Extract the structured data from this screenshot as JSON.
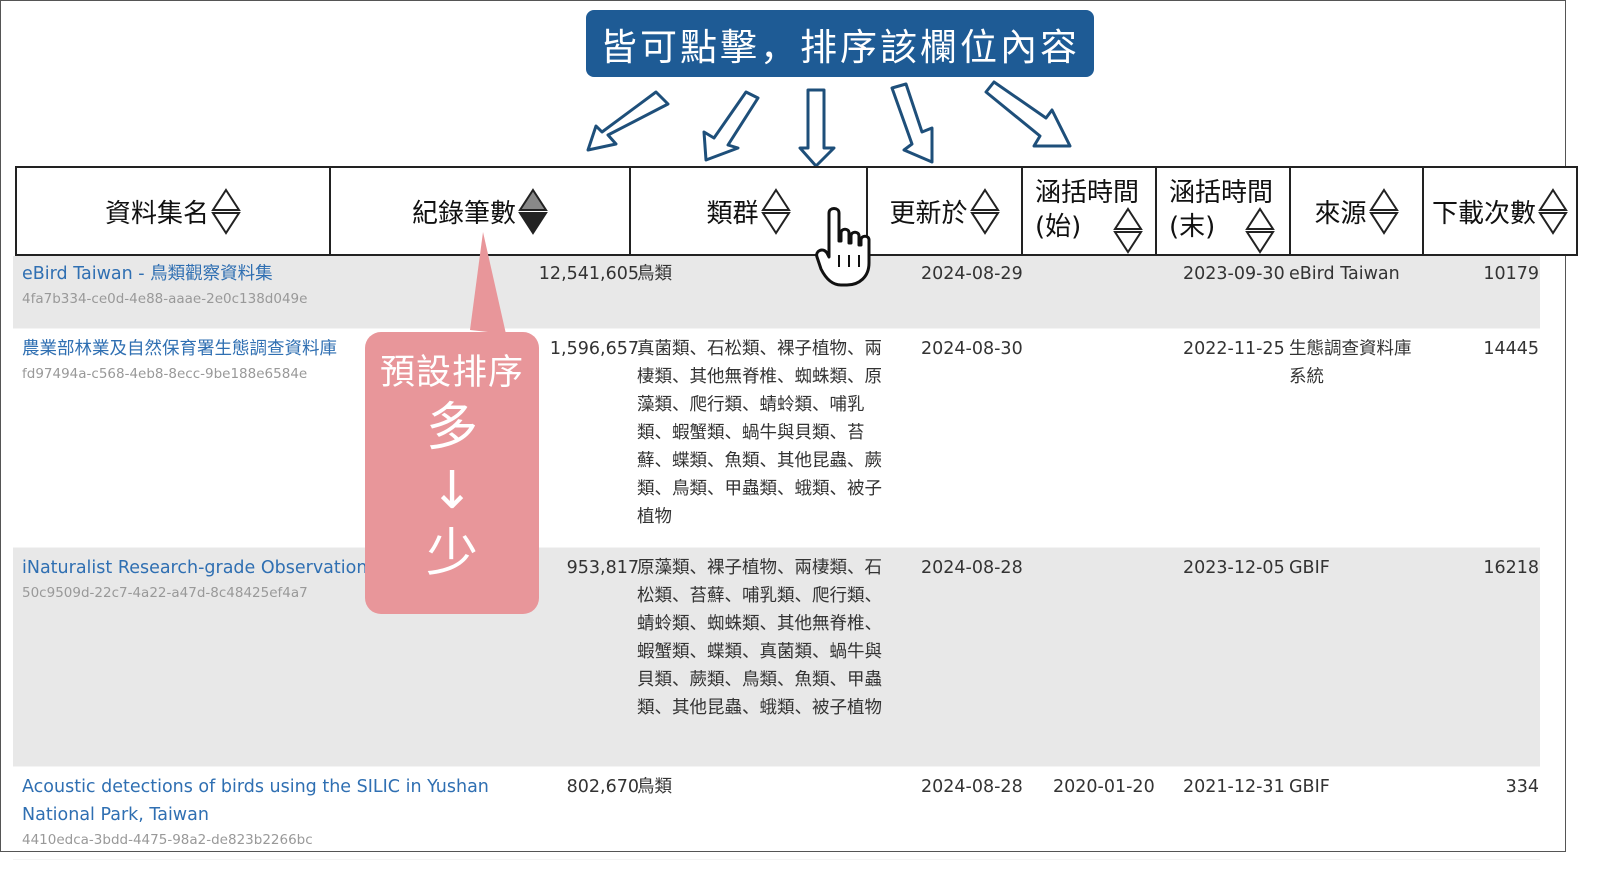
{
  "callout_top": {
    "text": "皆可點擊，排序該欄位內容",
    "color": "#1e5b95"
  },
  "callout_sort": {
    "line1": "預設排序",
    "line2": "多",
    "arrow": "↓",
    "line3": "少",
    "color": "#e8969a"
  },
  "headers": [
    {
      "label": "資料集名",
      "icon": "sort-both-icon"
    },
    {
      "label": "紀錄筆數",
      "icon": "sort-desc-active-icon"
    },
    {
      "label": "類群",
      "icon": "sort-both-icon"
    },
    {
      "label": "更新於",
      "icon": "sort-both-icon"
    },
    {
      "label_line1": "涵括時間",
      "label_line2": "(始)",
      "icon": "sort-both-icon"
    },
    {
      "label_line1": "涵括時間",
      "label_line2": "(末)",
      "icon": "sort-both-icon"
    },
    {
      "label": "來源",
      "icon": "sort-both-icon"
    },
    {
      "label": "下載次數",
      "icon": "sort-both-icon"
    }
  ],
  "rows": [
    {
      "name": "eBird Taiwan - 鳥類觀察資料集",
      "uuid": "4fa7b334-ce0d-4e88-aaae-2e0c138d049e",
      "records": "12,541,605",
      "taxa": "鳥類",
      "updated": "2024-08-29",
      "start": "",
      "end": "2023-09-30",
      "source": "eBird Taiwan",
      "downloads": "10179"
    },
    {
      "name": "農業部林業及自然保育署生態調查資料庫",
      "uuid": "fd97494a-c568-4eb8-8ecc-9be188e6584e",
      "records": "1,596,657",
      "taxa": "真菌類、石松類、裸子植物、兩棲類、其他無脊椎、蜘蛛類、原藻類、爬行類、蜻蛉類、哺乳類、蝦蟹類、蝸牛與貝類、苔蘚、蝶類、魚類、其他昆蟲、蕨類、鳥類、甲蟲類、蛾類、被子植物",
      "updated": "2024-08-30",
      "start": "",
      "end": "2022-11-25",
      "source": "生態調查資料庫系統",
      "downloads": "14445"
    },
    {
      "name": "iNaturalist Research-grade Observations",
      "uuid": "50c9509d-22c7-4a22-a47d-8c48425ef4a7",
      "records": "953,817",
      "taxa": "原藻類、裸子植物、兩棲類、石松類、苔蘚、哺乳類、爬行類、蜻蛉類、蜘蛛類、其他無脊椎、蝦蟹類、蝶類、真菌類、蝸牛與貝類、蕨類、鳥類、魚類、甲蟲類、其他昆蟲、蛾類、被子植物",
      "updated": "2024-08-28",
      "start": "",
      "end": "2023-12-05",
      "source": "GBIF",
      "downloads": "16218"
    },
    {
      "name": "Acoustic detections of birds using the SILIC in Yushan National Park, Taiwan",
      "uuid": "4410edca-3bdd-4475-98a2-de823b2266bc",
      "records": "802,670",
      "taxa": "鳥類",
      "updated": "2024-08-28",
      "start": "2020-01-20",
      "end": "2021-12-31",
      "source": "GBIF",
      "downloads": "334"
    }
  ],
  "colors": {
    "link": "#2f6fb2",
    "uuid": "#999999",
    "shade": "#e8e8e8",
    "arrow": "#1e4f7a"
  }
}
